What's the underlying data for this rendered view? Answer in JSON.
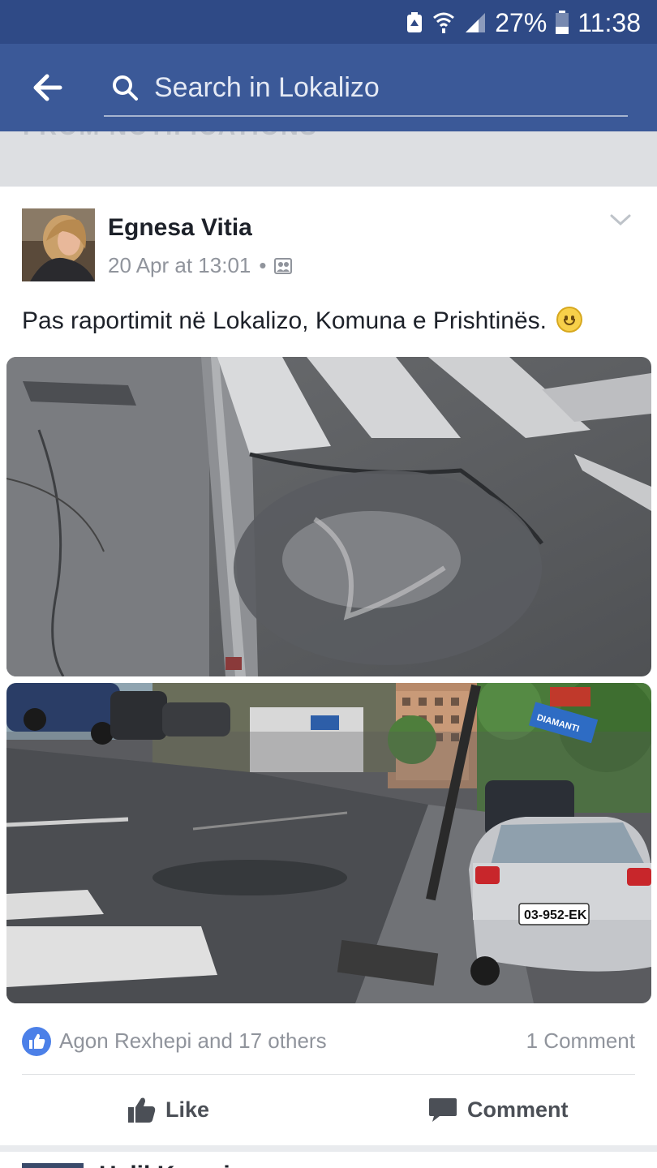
{
  "status_bar": {
    "battery_percent": "27%",
    "time": "11:38",
    "icons": [
      "battery-saver-icon",
      "wifi-calling-icon",
      "signal-icon",
      "battery-icon"
    ]
  },
  "search": {
    "placeholder": "Search in Lokalizo",
    "back_icon": "back-arrow-icon"
  },
  "section_header": "FROM NOTIFICATIONS",
  "post": {
    "author": "Egnesa Vitia",
    "date": "20 Apr at 13:01",
    "separator": "•",
    "audience_icon": "friends-audience-icon",
    "text": "Pas raportimit në Lokalizo, Komuna e Prishtinës.",
    "emoji": "smiley-emoji-icon",
    "photos": [
      {
        "name": "pothole-closeup-photo"
      },
      {
        "name": "street-with-cars-photo",
        "sign_text": "DIAMANTI",
        "plate_text": "03-952-EK"
      }
    ],
    "reactions": {
      "likers": "Agon Rexhepi and 17 others",
      "comment_count": "1 Comment"
    },
    "actions": {
      "like_label": "Like",
      "comment_label": "Comment"
    }
  },
  "next_post": {
    "author_partial": "Halil Kryeziu"
  },
  "colors": {
    "status_bar": "#2f4a86",
    "header": "#3b5998",
    "like_blue": "#4c80e8",
    "text": "#1d2129",
    "muted": "#90949c"
  }
}
